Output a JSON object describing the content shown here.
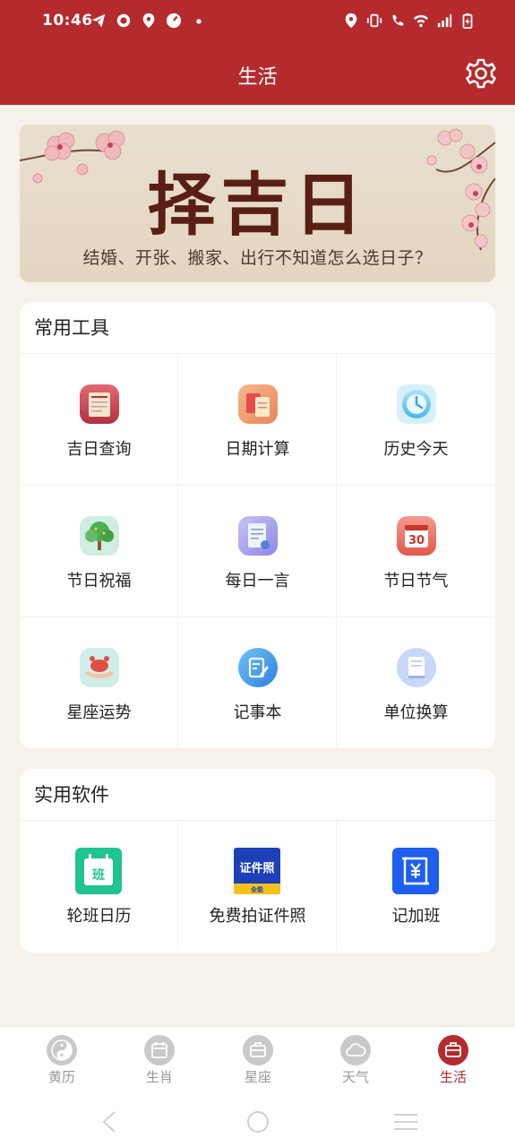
{
  "status": {
    "time": "10:46"
  },
  "header": {
    "title": "生活"
  },
  "banner": {
    "title": "择吉日",
    "subtitle": "结婚、开张、搬家、出行不知道怎么选日子？"
  },
  "tools": {
    "title": "常用工具",
    "items": [
      {
        "label": "吉日查询"
      },
      {
        "label": "日期计算"
      },
      {
        "label": "历史今天"
      },
      {
        "label": "节日祝福"
      },
      {
        "label": "每日一言"
      },
      {
        "label": "节日节气"
      },
      {
        "label": "星座运势"
      },
      {
        "label": "记事本"
      },
      {
        "label": "单位换算"
      }
    ]
  },
  "software": {
    "title": "实用软件",
    "items": [
      {
        "label": "轮班日历",
        "icon_text": "班"
      },
      {
        "label": "免费拍证件照",
        "icon_text": "证件照",
        "icon_badge": "全能"
      },
      {
        "label": "记加班"
      }
    ]
  },
  "nav": {
    "items": [
      {
        "label": "黄历"
      },
      {
        "label": "生肖"
      },
      {
        "label": "星座"
      },
      {
        "label": "天气"
      },
      {
        "label": "生活"
      }
    ],
    "active_color": "#b52b2d"
  },
  "colors": {
    "header": "#b52b2d",
    "background": "#f6f1ea"
  },
  "icons": {
    "banner_calendar_icon_text": "30"
  }
}
